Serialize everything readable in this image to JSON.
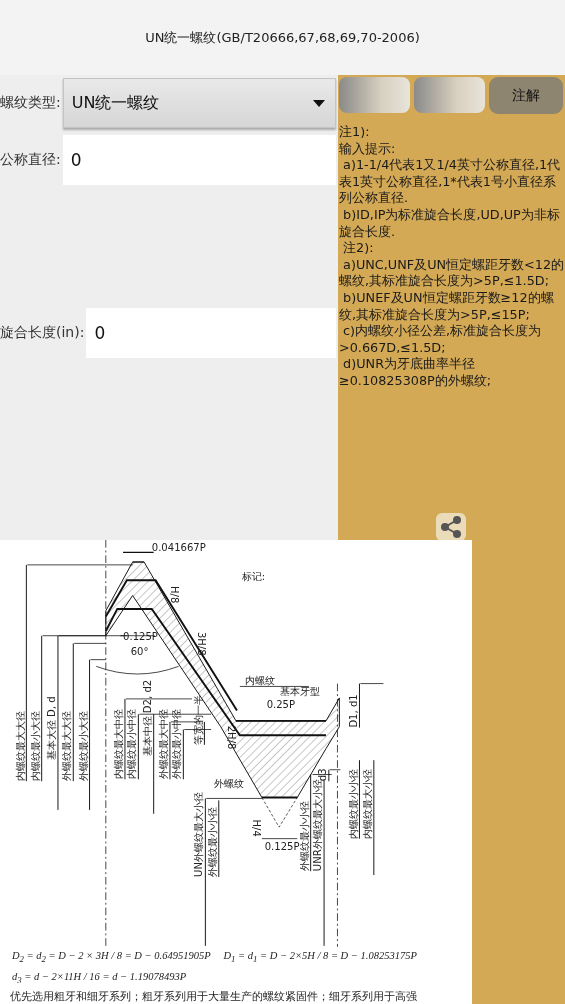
{
  "header": {
    "title": "UN统一螺纹(GB/T20666,67,68,69,70-2006)"
  },
  "form": {
    "thread_type": {
      "label": "螺纹类型:",
      "value": "UN统一螺纹"
    },
    "fields": [
      {
        "label": "公称直径:",
        "value": "0"
      },
      {
        "label": "旋合长度(in):",
        "value": "0"
      }
    ]
  },
  "notes_panel": {
    "button": "注解",
    "notes": [
      "注1):",
      "输入提示:",
      " a)1-1/4代表1又1/4英寸公称直径,1代表1英寸公称直径,1*代表1号小直径系列公称直径.",
      " b)ID,IP为标准旋合长度,UD,UP为非标旋合长度.",
      " 注2):",
      " a)UNC,UNF及UN恒定螺距牙数<12的螺纹,其标准旋合长度为>5P,≤1.5D;",
      " b)UNEF及UN恒定螺距牙数≥12的螺纹,其标准旋合长度为>5P,≤15P;",
      " c)内螺纹小径公差,标准旋合长度为>0.667D,≤1.5D;",
      " d)UNR为牙底曲率半径≥0.10825308P的外螺纹;"
    ]
  },
  "diagram": {
    "labels": [
      "0.041667P",
      "标记:",
      "内螺纹",
      "基本牙型",
      "0.25P",
      "0.125P",
      "60°",
      "外螺纹",
      "0.125P",
      "H/8",
      "3H/8",
      "2H/8",
      "H/4",
      "内螺纹最大大径",
      "内螺纹最小大径",
      "基本大径 D, d",
      "外螺纹最大大径",
      "外螺纹最小大径",
      "内螺纹最大中径",
      "内螺纹最小中径",
      "基本中径 D2, d2",
      "外螺纹最大中径",
      "外螺纹最小中径",
      "等宽的一半",
      "UN外螺纹最大小径",
      "外螺纹最小小径",
      "外螺纹最小小径",
      "UNR外螺纹最大小径",
      "内螺纹最小小径",
      "内螺纹最大小径",
      "D1, d1",
      "d3"
    ],
    "formulas": [
      "D$_{2}$ = d$_{2}$ = D − 2 × 3H / 8 = D − 0.64951905P     D$_{1}$ = d$_{1}$ = D − 2×5H / 8 = D − 1.08253175P",
      "d$_{3}$ = d − 2×11H / 16 = d − 1.19078493P"
    ],
    "caption": "优先选用粗牙和细牙系列；粗牙系列用于大量生产的螺纹紧固件；细牙系列用于高强"
  }
}
